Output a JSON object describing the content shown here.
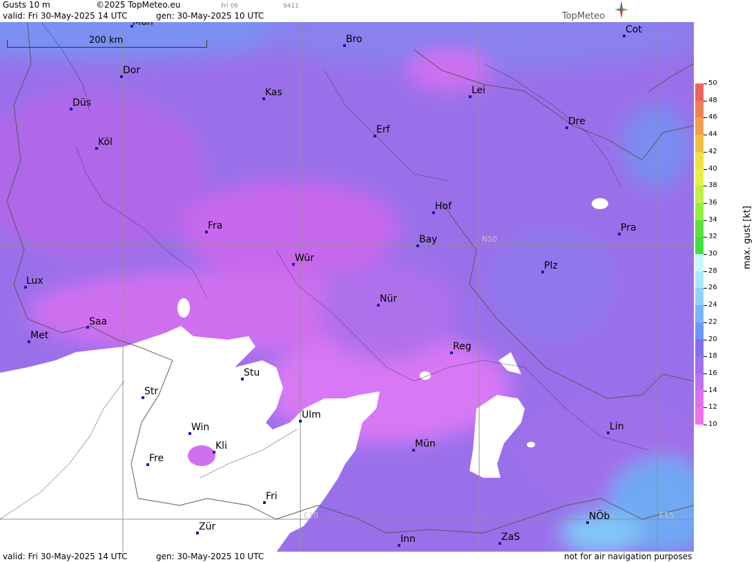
{
  "header": {
    "product": "Gusts 10 m",
    "copyright": "©2025 TopMeteo.eu",
    "day_code": "Fri 06",
    "map_id": "9411",
    "valid": "valid:  Fri  30-May-2025  14 UTC",
    "generated": "gen: 30-May-2025 10 UTC",
    "logo": "TopMeteo"
  },
  "footer": {
    "valid": "valid:  Fri  30-May-2025  14 UTC",
    "generated": "gen: 30-May-2025 10 UTC",
    "notice": "not for air navigation purposes"
  },
  "map": {
    "scale_label": "200 km",
    "grid_labels": {
      "lat": "N50",
      "lon1": "E10",
      "lon2": "E15"
    },
    "cities": [
      {
        "name": "Mün",
        "id": "mun-north"
      },
      {
        "name": "Bro"
      },
      {
        "name": "Cot"
      },
      {
        "name": "Dor"
      },
      {
        "name": "Kas"
      },
      {
        "name": "Lei"
      },
      {
        "name": "Düs"
      },
      {
        "name": "Erf"
      },
      {
        "name": "Dre"
      },
      {
        "name": "Köl"
      },
      {
        "name": "Hof"
      },
      {
        "name": "Fra"
      },
      {
        "name": "Pra"
      },
      {
        "name": "Bay"
      },
      {
        "name": "Wür"
      },
      {
        "name": "Plz"
      },
      {
        "name": "Lux"
      },
      {
        "name": "Nür"
      },
      {
        "name": "Saa"
      },
      {
        "name": "Met"
      },
      {
        "name": "Reg"
      },
      {
        "name": "Stu"
      },
      {
        "name": "Str"
      },
      {
        "name": "Ulm"
      },
      {
        "name": "Win"
      },
      {
        "name": "Lin"
      },
      {
        "name": "Kli"
      },
      {
        "name": "Mün"
      },
      {
        "name": "Fre"
      },
      {
        "name": "Fri"
      },
      {
        "name": "NÖb"
      },
      {
        "name": "Zür"
      },
      {
        "name": "Inn"
      },
      {
        "name": "ZaS"
      }
    ]
  },
  "legend": {
    "unit_label": "max. gust  [kt]",
    "ticks": [
      "50",
      "48",
      "46",
      "44",
      "42",
      "40",
      "38",
      "36",
      "34",
      "32",
      "30",
      "28",
      "26",
      "24",
      "22",
      "20",
      "18",
      "16",
      "14",
      "12",
      "10"
    ],
    "colors": [
      "#f06060",
      "#f08050",
      "#f0a050",
      "#f0c040",
      "#f0e040",
      "#e8f040",
      "#c0f040",
      "#90f040",
      "#60e040",
      "#40e040",
      "#c8f8ff",
      "#a8e8ff",
      "#90d0ff",
      "#7ab4ff",
      "#6e96ff",
      "#8070f0",
      "#a070f0",
      "#c070f0",
      "#e070f0",
      "#f070f0"
    ]
  },
  "colors": {
    "white_area": "#ffffff",
    "lavender": "#c860e8",
    "violet": "#9070e8",
    "blue": "#7090f0"
  }
}
